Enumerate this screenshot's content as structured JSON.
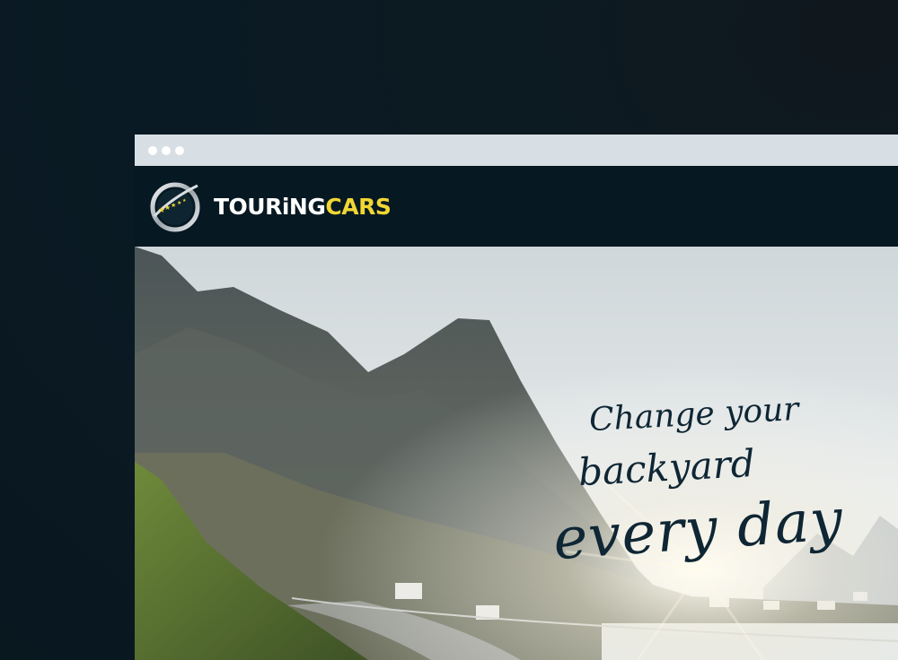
{
  "browser": {
    "window_controls": [
      "dot-1",
      "dot-2",
      "dot-3"
    ]
  },
  "header": {
    "logo_icon": "globe-stars-icon",
    "brand_part1": "TOURiNG",
    "brand_part2": "CARS",
    "brand_color": "#f1d634",
    "background": "#061822"
  },
  "hero": {
    "line1": "Change your",
    "line2": "backyard",
    "line3": "every day",
    "image": "mountain-road-photo"
  }
}
